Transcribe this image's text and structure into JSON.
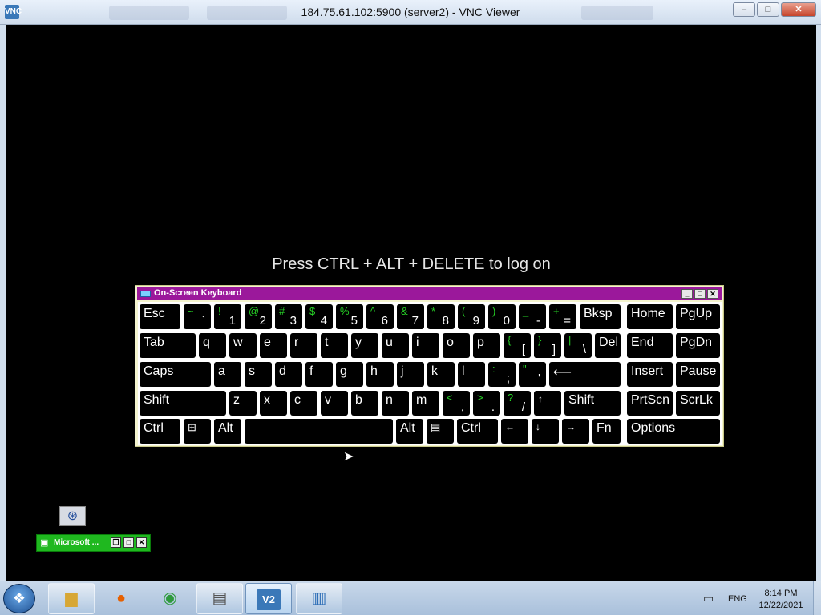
{
  "window": {
    "app_icon": "VNC",
    "title": "184.75.61.102:5900 (server2) - VNC Viewer",
    "controls": {
      "minimize": "–",
      "maximize": "□",
      "close": "✕"
    }
  },
  "remote": {
    "logon_message": "Press CTRL + ALT + DELETE to log on"
  },
  "osk": {
    "title": "On-Screen Keyboard",
    "controls": {
      "minimize": "_",
      "maximize": "□",
      "close": "✕"
    },
    "row1": {
      "esc": "Esc",
      "tilde": {
        "up": "~",
        "low": "`"
      },
      "k1": {
        "up": "!",
        "low": "1"
      },
      "k2": {
        "up": "@",
        "low": "2"
      },
      "k3": {
        "up": "#",
        "low": "3"
      },
      "k4": {
        "up": "$",
        "low": "4"
      },
      "k5": {
        "up": "%",
        "low": "5"
      },
      "k6": {
        "up": "^",
        "low": "6"
      },
      "k7": {
        "up": "&",
        "low": "7"
      },
      "k8": {
        "up": "*",
        "low": "8"
      },
      "k9": {
        "up": "(",
        "low": "9"
      },
      "k0": {
        "up": ")",
        "low": "0"
      },
      "minus": {
        "up": "_",
        "low": "-"
      },
      "equals": {
        "up": "+",
        "low": "="
      },
      "bksp": "Bksp",
      "home": "Home",
      "pgup": "PgUp"
    },
    "row2": {
      "tab": "Tab",
      "q": "q",
      "w": "w",
      "e": "e",
      "r": "r",
      "t": "t",
      "y": "y",
      "u": "u",
      "i": "i",
      "o": "o",
      "p": "p",
      "lbrace": {
        "up": "{",
        "low": "["
      },
      "rbrace": {
        "up": "}",
        "low": "]"
      },
      "pipe": {
        "up": "|",
        "low": "\\"
      },
      "del": "Del",
      "end": "End",
      "pgdn": "PgDn"
    },
    "row3": {
      "caps": "Caps",
      "a": "a",
      "s": "s",
      "d": "d",
      "f": "f",
      "g": "g",
      "h": "h",
      "j": "j",
      "k": "k",
      "l": "l",
      "semicolon": {
        "up": ":",
        "low": ";"
      },
      "quote": {
        "up": "\"",
        "low": "'"
      },
      "enter": "⟵",
      "insert": "Insert",
      "pause": "Pause"
    },
    "row4": {
      "shift_left": "Shift",
      "z": "z",
      "x": "x",
      "c": "c",
      "v": "v",
      "b": "b",
      "n": "n",
      "m": "m",
      "comma": {
        "up": "<",
        "low": ","
      },
      "period": {
        "up": ">",
        "low": "."
      },
      "slash": {
        "up": "?",
        "low": "/"
      },
      "up_arrow": "↑",
      "shift_right": "Shift",
      "prtscn": "PrtScn",
      "scrlk": "ScrLk"
    },
    "row5": {
      "ctrl_left": "Ctrl",
      "win": "⊞",
      "alt_left": "Alt",
      "space": "",
      "alt_right": "Alt",
      "menu": "▤",
      "ctrl_right": "Ctrl",
      "left_arrow": "←",
      "down_arrow": "↓",
      "right_arrow": "→",
      "fn": "Fn",
      "options": "Options"
    }
  },
  "desktop": {
    "minimized_window": {
      "label": "Microsoft ...",
      "controls": [
        "❐",
        "□",
        "✕"
      ]
    }
  },
  "taskbar": {
    "icons": [
      "windows-start-icon",
      "file-explorer-icon",
      "firefox-icon",
      "chrome-icon",
      "image-viewer-icon",
      "vnc-viewer-icon",
      "remote-desktop-icon"
    ],
    "vnc_label": "V2",
    "language": "ENG",
    "time": "8:14 PM",
    "date": "12/22/2021"
  }
}
